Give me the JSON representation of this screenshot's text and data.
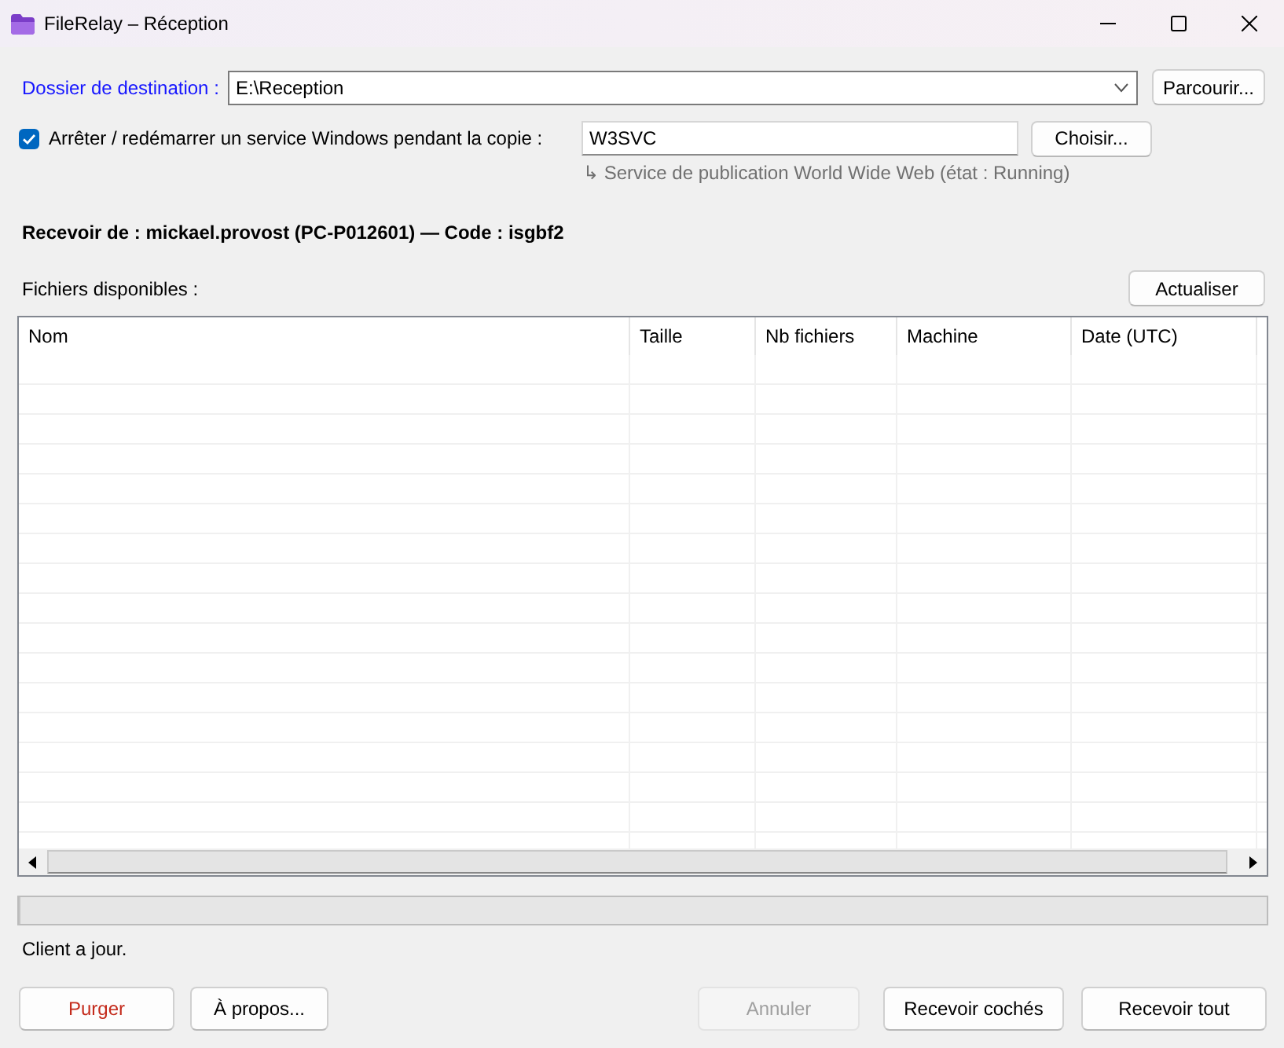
{
  "window": {
    "title": "FileRelay – Réception"
  },
  "destination": {
    "label": "Dossier de destination :",
    "value": "E:\\Reception",
    "button": "Parcourir..."
  },
  "service": {
    "checked": true,
    "label": "Arrêter / redémarrer un service Windows pendant la copie :",
    "value": "W3SVC",
    "button": "Choisir...",
    "hint": "↳ Service de publication World Wide Web (état : Running)"
  },
  "sender": {
    "text": "Recevoir de : mickael.provost (PC-P012601) — Code : isgbf2"
  },
  "files": {
    "label": "Fichiers disponibles :",
    "refresh_button": "Actualiser",
    "columns": [
      "Nom",
      "Taille",
      "Nb fichiers",
      "Machine",
      "Date (UTC)"
    ]
  },
  "progress": {
    "level": 0
  },
  "status": "Client a jour.",
  "footer": {
    "left_buttons": [
      {
        "label": "Purger",
        "kind": "danger",
        "disabled": false
      },
      {
        "label": "À propos...",
        "kind": "normal",
        "disabled": false
      }
    ],
    "right_buttons": [
      {
        "label": "Annuler",
        "kind": "normal",
        "disabled": true
      },
      {
        "label": "Recevoir cochés",
        "kind": "normal",
        "disabled": false
      },
      {
        "label": "Recevoir tout",
        "kind": "normal",
        "disabled": false
      }
    ]
  }
}
